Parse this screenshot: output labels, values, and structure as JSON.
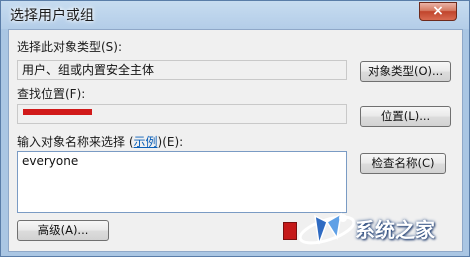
{
  "window": {
    "title": "选择用户或组",
    "close_glyph": "×"
  },
  "object_type": {
    "label": "选择此对象类型(S):",
    "value": "用户、组或内置安全主体",
    "button": "对象类型(O)..."
  },
  "location": {
    "label": "查找位置(F):",
    "button": "位置(L)..."
  },
  "names": {
    "label_prefix": "输入对象名称来选择 (",
    "label_link": "示例",
    "label_suffix": ")(E):",
    "value": "everyone",
    "check_button": "检查名称(C)"
  },
  "footer": {
    "advanced_button": "高级(A)..."
  },
  "watermark": {
    "text": "系统之家"
  },
  "colors": {
    "location_redacted": "#d11a1a",
    "link": "#0a5fb8",
    "close_button": "#c0442c"
  }
}
